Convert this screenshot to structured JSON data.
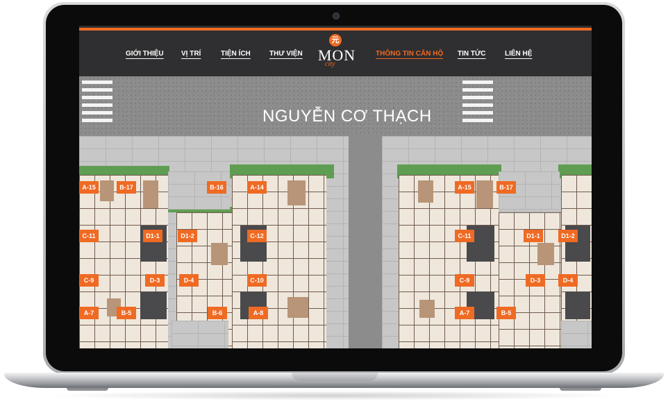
{
  "nav": {
    "items": [
      "GIỚI THIỆU",
      "VỊ TRÍ",
      "TIỆN ÍCH",
      "THƯ VIỆN",
      "THÔNG TIN CĂN HỘ",
      "TIN TỨC",
      "LIÊN HỆ"
    ],
    "active": "THÔNG TIN CĂN HỘ",
    "logo": {
      "mark": "元",
      "text": "MON",
      "sub": "city"
    }
  },
  "map": {
    "street_name": "NGUYỄN CƠ THẠCH",
    "labels_left": [
      "A-15",
      "B-17",
      "B-16",
      "A-14",
      "C-11",
      "D1-1",
      "D1-2",
      "C-12",
      "C-9",
      "D-3",
      "D-4",
      "C-10",
      "A-7",
      "B-5",
      "B-6",
      "A-8"
    ],
    "labels_right": [
      "A-15",
      "B-17",
      "C-11",
      "D1-1",
      "D1-2",
      "C-9",
      "D-3",
      "D-4",
      "A-7",
      "B-5"
    ]
  },
  "colors": {
    "accent": "#ef6a23",
    "nav_bg": "#2f2e30",
    "bezel": "#0b0b0c"
  }
}
